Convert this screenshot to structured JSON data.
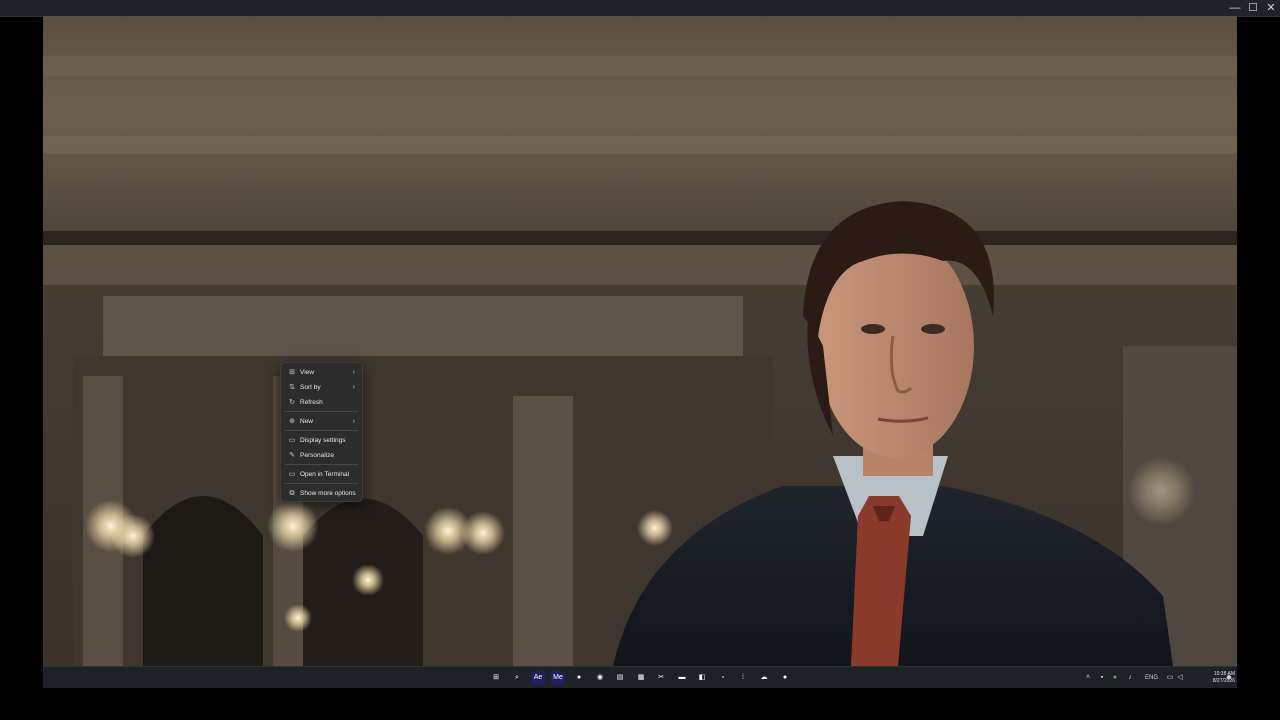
{
  "window": {
    "controls": {
      "minimize": "—",
      "maximize": "☐",
      "close": "✕"
    }
  },
  "context_menu": {
    "items": [
      {
        "label": "View",
        "icon": "grid-icon",
        "glyph": "⊞",
        "submenu": true
      },
      {
        "label": "Sort by",
        "icon": "sort-icon",
        "glyph": "⇅",
        "submenu": true
      },
      {
        "label": "Refresh",
        "icon": "refresh-icon",
        "glyph": "↻",
        "submenu": false
      },
      {
        "label": "New",
        "icon": "new-icon",
        "glyph": "⊕",
        "submenu": true
      },
      {
        "label": "Display settings",
        "icon": "display-icon",
        "glyph": "▭",
        "submenu": false
      },
      {
        "label": "Personalize",
        "icon": "brush-icon",
        "glyph": "✎",
        "submenu": false
      },
      {
        "label": "Open in Terminal",
        "icon": "terminal-icon",
        "glyph": "▭",
        "submenu": false
      },
      {
        "label": "Show more options",
        "icon": "more-options-icon",
        "glyph": "⧉",
        "submenu": false
      }
    ],
    "chevron": "›"
  },
  "taskbar": {
    "icons": [
      {
        "name": "start-icon",
        "glyph": "⊞",
        "color": "#3aa0ff"
      },
      {
        "name": "search-icon",
        "glyph": "⌕",
        "color": "#ffffff"
      },
      {
        "name": "adobe-ae-icon",
        "glyph": "Ae",
        "color": "#1f1f5e"
      },
      {
        "name": "adobe-me-icon",
        "glyph": "Me",
        "color": "#1f1f5e"
      },
      {
        "name": "chrome-icon",
        "glyph": "●",
        "color": "#f2b71f"
      },
      {
        "name": "discord-icon",
        "glyph": "◉",
        "color": "#5865f2"
      },
      {
        "name": "notes-icon",
        "glyph": "▤",
        "color": "#ffffff"
      },
      {
        "name": "calendar-icon",
        "glyph": "▦",
        "color": "#e04a3c"
      },
      {
        "name": "capcut-icon",
        "glyph": "✂",
        "color": "#ffffff"
      },
      {
        "name": "file-explorer-icon",
        "glyph": "▬",
        "color": "#f5c242"
      },
      {
        "name": "paint-icon",
        "glyph": "◧",
        "color": "#7fc4ff"
      },
      {
        "name": "app-grey-icon",
        "glyph": "▫",
        "color": "#777777"
      },
      {
        "name": "app-dots-icon",
        "glyph": "⁞",
        "color": "#bbbbbb"
      },
      {
        "name": "onedrive-icon",
        "glyph": "☁",
        "color": "#ffffff"
      },
      {
        "name": "record-icon",
        "glyph": "●",
        "color": "#e53935"
      }
    ],
    "tray": {
      "chevron": "˄",
      "lang": "ENG",
      "time": "10:38 AM",
      "date": "8/27/2026"
    }
  }
}
